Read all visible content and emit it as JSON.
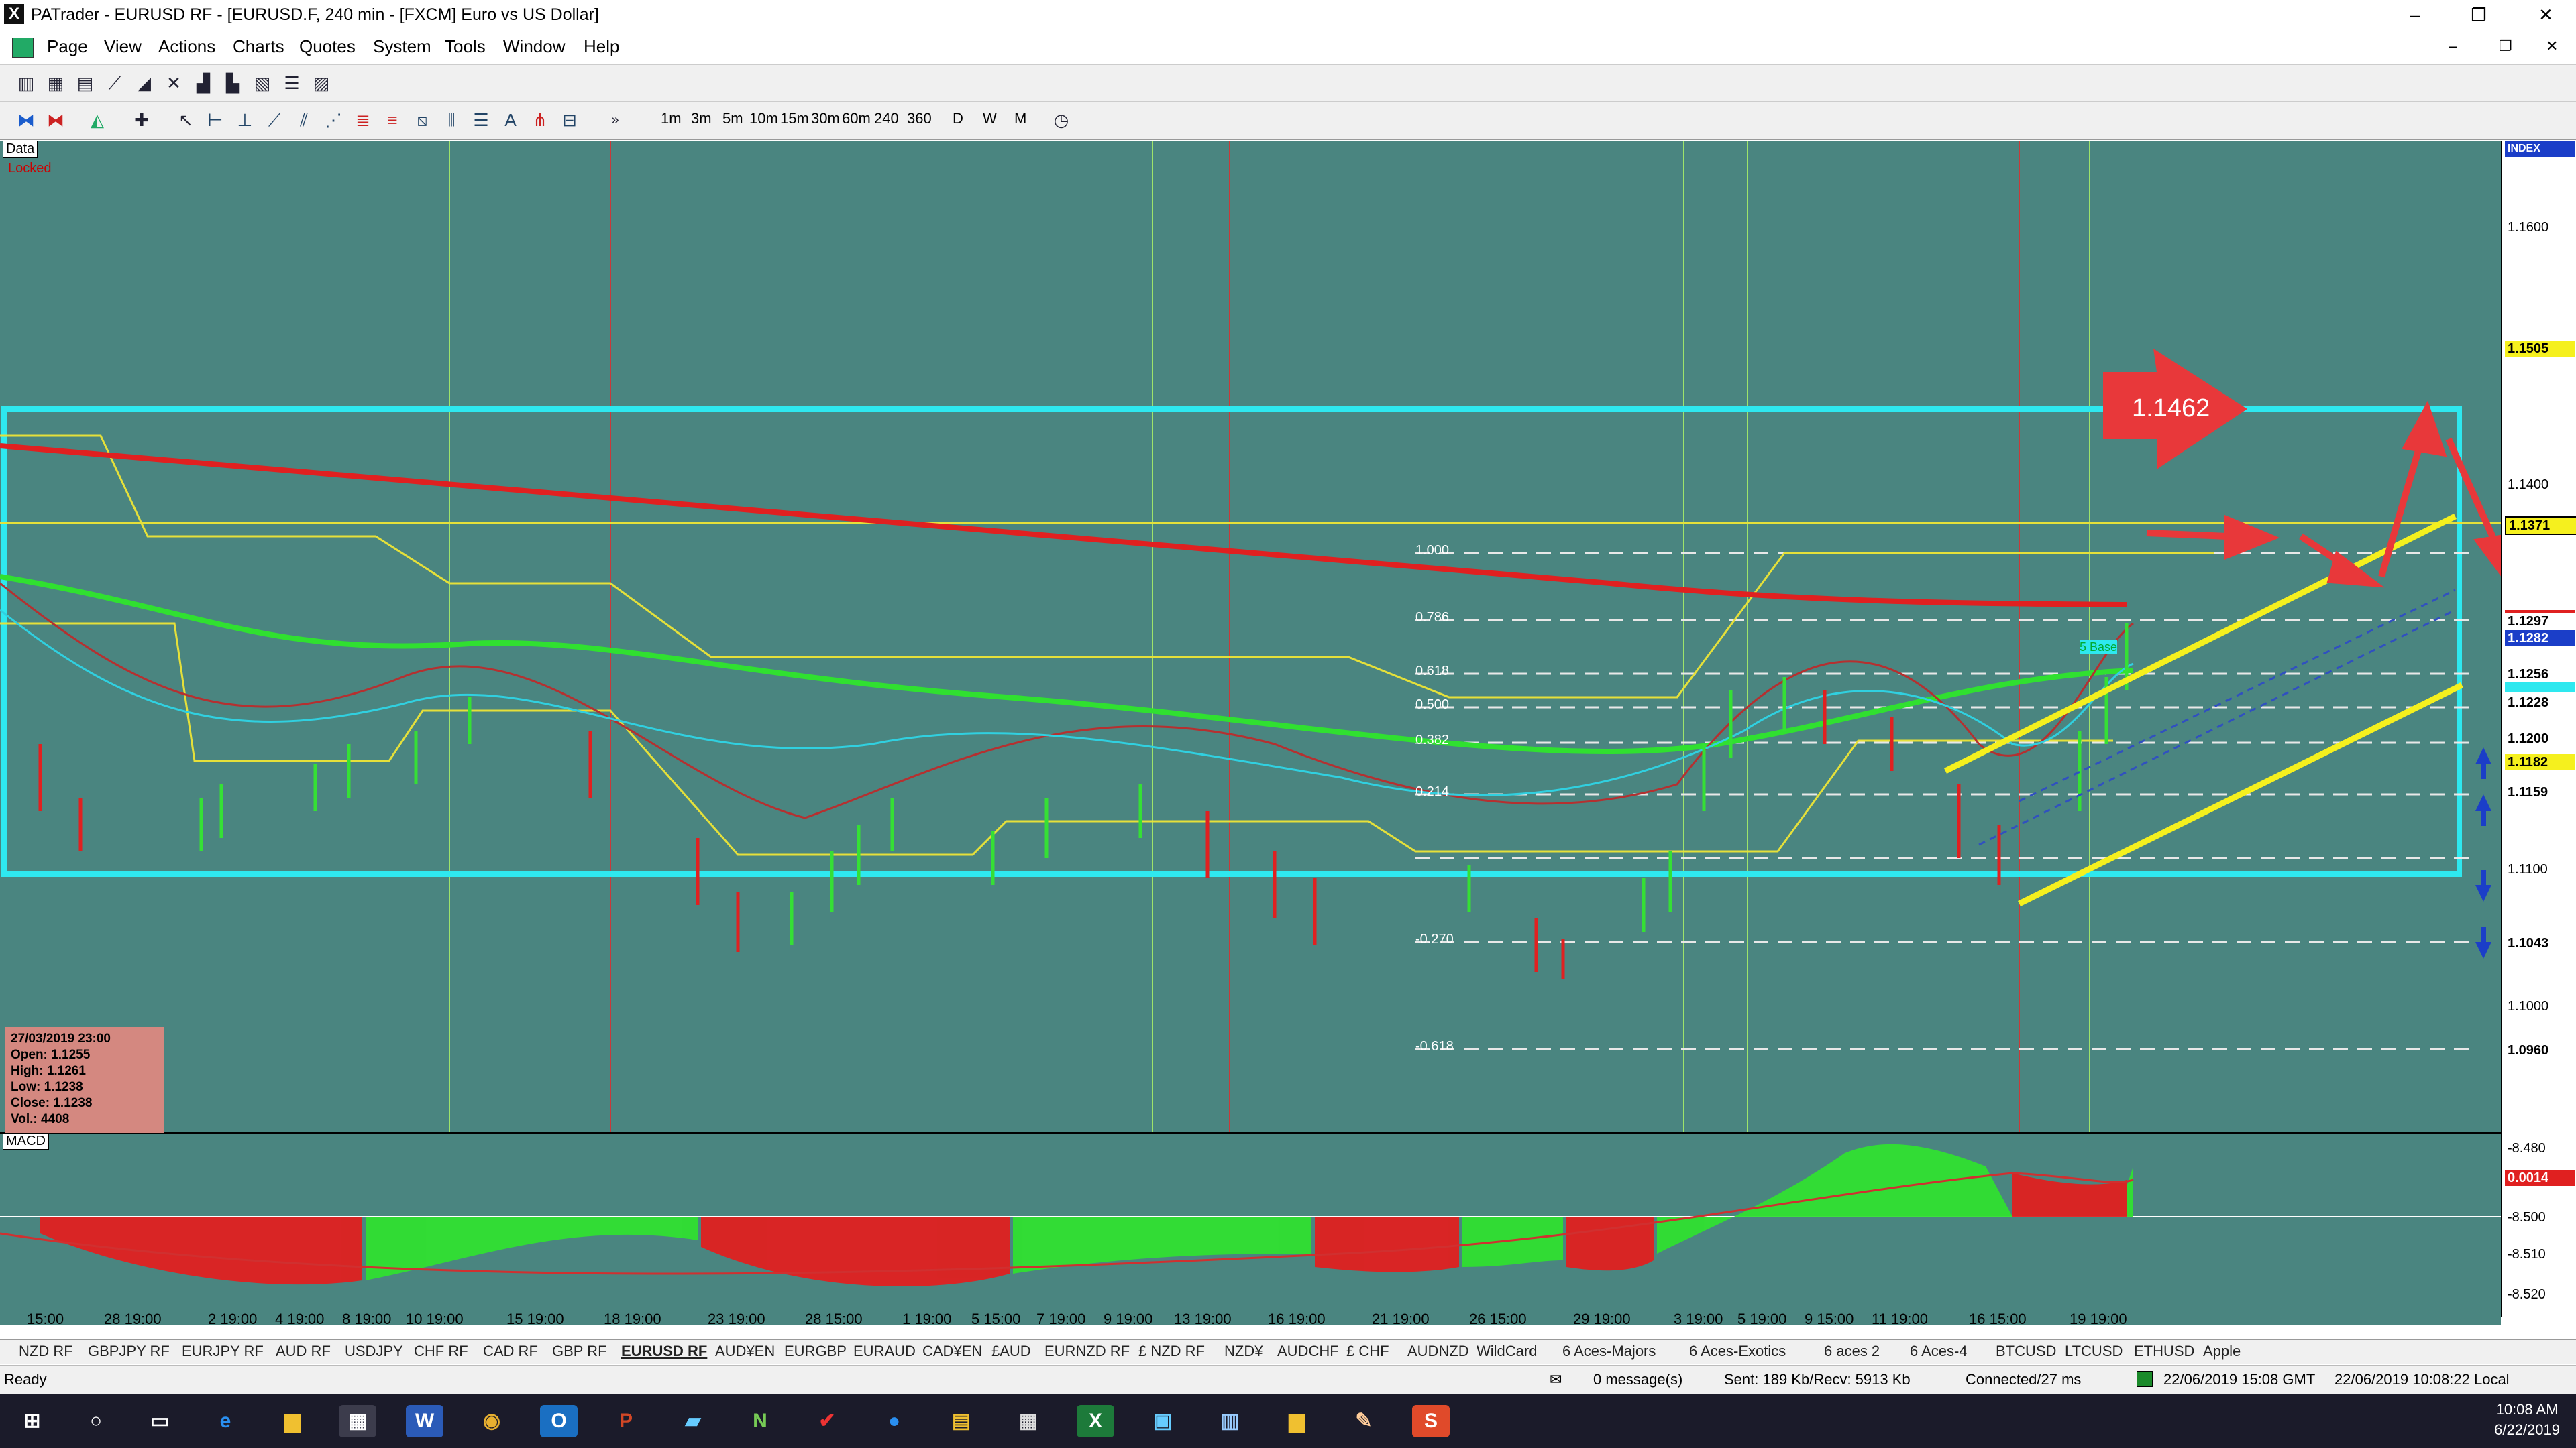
{
  "window": {
    "app_icon": "X",
    "title": "PATrader - EURUSD RF - [EURUSD.F, 240 min - [FXCM] Euro vs US Dollar]",
    "minimize": "–",
    "maximize": "❐",
    "close": "✕"
  },
  "menu": [
    "Page",
    "View",
    "Actions",
    "Charts",
    "Quotes",
    "System",
    "Tools",
    "Window",
    "Help"
  ],
  "toolbar": {
    "timeframes": [
      "1m",
      "3m",
      "5m",
      "10m",
      "15m",
      "30m",
      "60m",
      "240",
      "360",
      "D",
      "W",
      "M"
    ]
  },
  "chart": {
    "data_label": "Data",
    "locked_label": "Locked",
    "index_label": "INDEX",
    "price_ticks": [
      "1.1600",
      "1.1505",
      "1.1400",
      "1.1371",
      "1.1297",
      "1.1282",
      "1.1256",
      "1.1228",
      "1.1200",
      "1.1182",
      "1.1159",
      "1.1100",
      "1.1043",
      "1.1000",
      "1.0960"
    ],
    "fib_labels": [
      "1.000",
      "0.786",
      "0.618",
      "0.500",
      "0.382",
      "0.214",
      "-0.270",
      "-0.618"
    ],
    "annotation_value": "1.1462",
    "base_label": "5 Base",
    "info": {
      "date": "27/03/2019 23:00",
      "open": "Open: 1.1255",
      "high": "High: 1.1261",
      "low": "Low: 1.1238",
      "close": "Close: 1.1238",
      "vol": "Vol.: 4408"
    },
    "macd_label": "MACD",
    "macd_ticks": [
      "-8.480",
      "-8.500",
      "-8.510",
      "-8.520"
    ],
    "macd_value": "0.0014",
    "time_labels": [
      "15:00",
      "28 19:00",
      "2 19:00",
      "4 19:00",
      "8 19:00",
      "10 19:00",
      "15 19:00",
      "18 19:00",
      "23 19:00",
      "28 15:00",
      "1 19:00",
      "5 15:00",
      "7 19:00",
      "9 19:00",
      "13 19:00",
      "16 19:00",
      "21 19:00",
      "26 15:00",
      "29 19:00",
      "3 19:00",
      "5 19:00",
      "9 15:00",
      "11 19:00",
      "16 15:00",
      "19 19:00"
    ],
    "colors": {
      "background": "#4a8580",
      "channel": "#2ee8ef",
      "ma_long": "#e02020",
      "ma_green": "#30e030",
      "trend": "#f5f01e",
      "arrow": "#e8383a"
    }
  },
  "symbol_tabs": [
    "NZD RF",
    "GBPJPY RF",
    "EURJPY RF",
    "AUD RF",
    "USDJPY",
    "CHF RF",
    "CAD RF",
    "GBP RF",
    "EURUSD RF",
    "AUD¥EN",
    "EURGBP",
    "EURAUD",
    "CAD¥EN",
    "£AUD",
    "EURNZD RF",
    "£ NZD RF",
    "NZD¥",
    "AUDCHF",
    "£ CHF",
    "AUDNZD",
    "WildCard",
    "6 Aces-Majors",
    "6 Aces-Exotics",
    "6 aces 2",
    "6 Aces-4",
    "BTCUSD",
    "LTCUSD",
    "ETHUSD",
    "Apple"
  ],
  "active_symbol_tab": "EURUSD RF",
  "status": {
    "ready": "Ready",
    "messages": "0 message(s)",
    "traffic": "Sent: 189 Kb/Recv: 5913 Kb",
    "connection": "Connected/27 ms",
    "gmt": "22/06/2019 15:08 GMT",
    "local": "22/06/2019 10:08:22 Local"
  },
  "taskbar": {
    "time": "10:08 AM",
    "date": "6/22/2019"
  }
}
